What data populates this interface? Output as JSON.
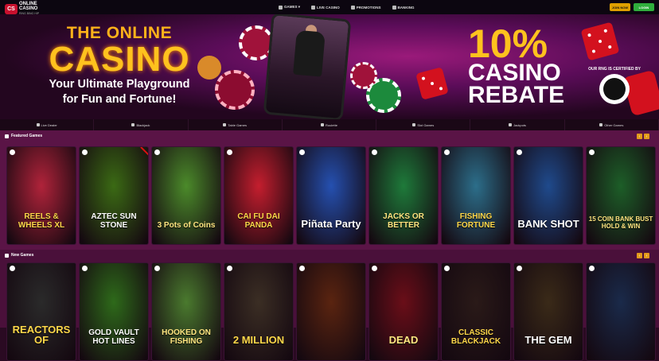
{
  "header": {
    "logo_badge": "CS",
    "logo_line1": "ONLINE",
    "logo_line2": "CASINO",
    "logo_tag": "RING BING HIP",
    "nav": [
      {
        "label": "GAMES ▾",
        "icon": "dice-icon"
      },
      {
        "label": "LIVE CASINO",
        "icon": "live-icon"
      },
      {
        "label": "PROMOTIONS",
        "icon": "gift-icon"
      },
      {
        "label": "BANKING",
        "icon": "bank-icon"
      }
    ],
    "join_label": "JOIN NOW",
    "login_label": "LOGIN",
    "join_color": "#e0a000",
    "login_color": "#2fae3c"
  },
  "banner": {
    "line1": "THE ONLINE",
    "line2": "CASINO",
    "tagline_1": "Your Ultimate Playground",
    "tagline_2": "for Fun and Fortune!",
    "rebate_pct": "10%",
    "rebate_line1": "CASINO",
    "rebate_line2": "REBATE",
    "cert_text": "OUR RNG IS CERTIFIED BY"
  },
  "categories": [
    {
      "label": "Live Dealer",
      "icon": "dealer-icon"
    },
    {
      "label": "Blackjack",
      "icon": "cards-icon"
    },
    {
      "label": "Table Games",
      "icon": "table-icon"
    },
    {
      "label": "Roulette",
      "icon": "roulette-icon"
    },
    {
      "label": "Slot Games",
      "icon": "slot-icon"
    },
    {
      "label": "Jackpots",
      "icon": "jackpot-icon"
    },
    {
      "label": "Other Games",
      "icon": "other-icon"
    }
  ],
  "featured": {
    "title": "Featured Games",
    "games": [
      {
        "title": "REELS & WHEELS XL",
        "bg": "#b0233a"
      },
      {
        "title": "AZTEC SUN STONE",
        "bg": "#3b6a14"
      },
      {
        "title": "3 Pots of Coins",
        "bg": "#4b8a2a"
      },
      {
        "title": "CAI FU DAI PANDA",
        "bg": "#c41e2e"
      },
      {
        "title": "Piñata Party",
        "bg": "#2550b0"
      },
      {
        "title": "JACKS OR BETTER",
        "bg": "#1e7a3a"
      },
      {
        "title": "FISHING FORTUNE",
        "bg": "#2c6e8a"
      },
      {
        "title": "BANK SHOT",
        "bg": "#1f4a8c"
      },
      {
        "title": "15 COIN BANK BUST HOLD & WIN",
        "bg": "#1d5e28"
      }
    ]
  },
  "new_games": {
    "title": "New Games",
    "games": [
      {
        "title": "REACTORS OF",
        "bg": "#2a2a2a"
      },
      {
        "title": "GOLD VAULT HOT LINES",
        "bg": "#2e6a1a"
      },
      {
        "title": "HOOKED ON FISHING",
        "bg": "#4a7a2e"
      },
      {
        "title": "2 MILLION",
        "bg": "#3b2e24"
      },
      {
        "title": "",
        "bg": "#5a2410"
      },
      {
        "title": "DEAD",
        "bg": "#6a0e18"
      },
      {
        "title": "CLASSIC BLACKJACK",
        "bg": "#2a1a18"
      },
      {
        "title": "THE GEM",
        "bg": "#3a2a18"
      },
      {
        "title": "",
        "bg": "#1a2a4a"
      }
    ]
  }
}
